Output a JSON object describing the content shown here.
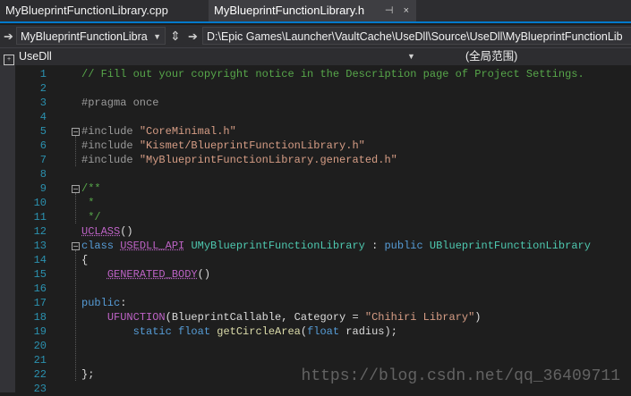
{
  "tabs": [
    {
      "label": "MyBlueprintFunctionLibrary.cpp",
      "active": false
    },
    {
      "label": "MyBlueprintFunctionLibrary.h",
      "active": true,
      "pin": "⊣",
      "close": "×"
    }
  ],
  "toolbar": {
    "file_combo": "MyBlueprintFunctionLibra",
    "path_combo": "D:\\Epic Games\\Launcher\\VaultCache\\UseDll\\Source\\UseDll\\MyBlueprintFunctionLib"
  },
  "navbar": {
    "project": "UseDll",
    "scope": "(全局范围)"
  },
  "lines": [
    {
      "n": "1",
      "fold": false,
      "html": "<span class=\"c-comment\">// Fill out your copyright notice in the Description page of Project Settings.</span>"
    },
    {
      "n": "2",
      "fold": false,
      "html": ""
    },
    {
      "n": "3",
      "fold": false,
      "html": "<span class=\"c-pp\">#pragma once</span>"
    },
    {
      "n": "4",
      "fold": false,
      "html": ""
    },
    {
      "n": "5",
      "fold": true,
      "html": "<span class=\"c-pp\">#include </span><span class=\"c-str\">\"CoreMinimal.h\"</span>"
    },
    {
      "n": "6",
      "fold": false,
      "html": "<span class=\"c-pp\">#include </span><span class=\"c-str\">\"Kismet/BlueprintFunctionLibrary.h\"</span>"
    },
    {
      "n": "7",
      "fold": false,
      "html": "<span class=\"c-pp\">#include </span><span class=\"c-str\">\"MyBlueprintFunctionLibrary.generated.h\"</span>"
    },
    {
      "n": "8",
      "fold": false,
      "html": ""
    },
    {
      "n": "9",
      "fold": true,
      "html": "<span class=\"c-comment\">/**</span>"
    },
    {
      "n": "10",
      "fold": false,
      "html": "<span class=\"c-comment\"> *</span>"
    },
    {
      "n": "11",
      "fold": false,
      "html": "<span class=\"c-comment\"> */</span>"
    },
    {
      "n": "12",
      "fold": false,
      "html": "<span class=\"c-macro squig\">UCLASS</span>()"
    },
    {
      "n": "13",
      "fold": true,
      "html": "<span class=\"c-kw\">class</span> <span class=\"c-macro squig\">USEDLL_API</span> <span class=\"c-type\">UMyBlueprintFunctionLibrary</span> : <span class=\"c-kw\">public</span> <span class=\"c-type\">UBlueprintFunctionLibrary</span>"
    },
    {
      "n": "14",
      "fold": false,
      "html": "{"
    },
    {
      "n": "15",
      "fold": false,
      "html": "    <span class=\"c-macro squig\">GENERATED_BODY</span>()"
    },
    {
      "n": "16",
      "fold": false,
      "html": ""
    },
    {
      "n": "17",
      "fold": false,
      "html": "<span class=\"c-kw\">public</span>:"
    },
    {
      "n": "18",
      "fold": false,
      "html": "    <span class=\"c-macro\">UFUNCTION</span>(BlueprintCallable, Category = <span class=\"c-str\">\"Chihiri Library\"</span>)"
    },
    {
      "n": "19",
      "fold": false,
      "html": "        <span class=\"c-kw\">static</span> <span class=\"c-kw\">float</span> <span class=\"c-fn\">getCircleArea</span>(<span class=\"c-kw\">float</span> radius);"
    },
    {
      "n": "20",
      "fold": false,
      "html": ""
    },
    {
      "n": "21",
      "fold": false,
      "html": ""
    },
    {
      "n": "22",
      "fold": false,
      "html": "};"
    },
    {
      "n": "23",
      "fold": false,
      "html": ""
    }
  ],
  "watermark": "https://blog.csdn.net/qq_36409711"
}
